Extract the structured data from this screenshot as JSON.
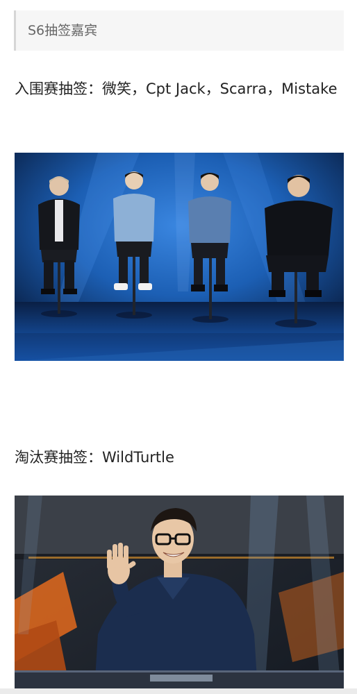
{
  "quote": {
    "text": "S6抽签嘉宾"
  },
  "sections": [
    {
      "text": "入围赛抽签：微笑，Cpt Jack，Scarra，Mistake",
      "photo_icon": "stage-photo-four-guests-seated"
    },
    {
      "text": "淘汰赛抽签：WildTurtle",
      "photo_icon": "stage-photo-guest-waving"
    }
  ],
  "colors": {
    "stage_blue": "#1c5fb4",
    "stage_dark": "#04102a",
    "stage_orange": "#d8661e",
    "quote_bg": "#f6f6f6",
    "quote_border": "#d6d6d6"
  }
}
